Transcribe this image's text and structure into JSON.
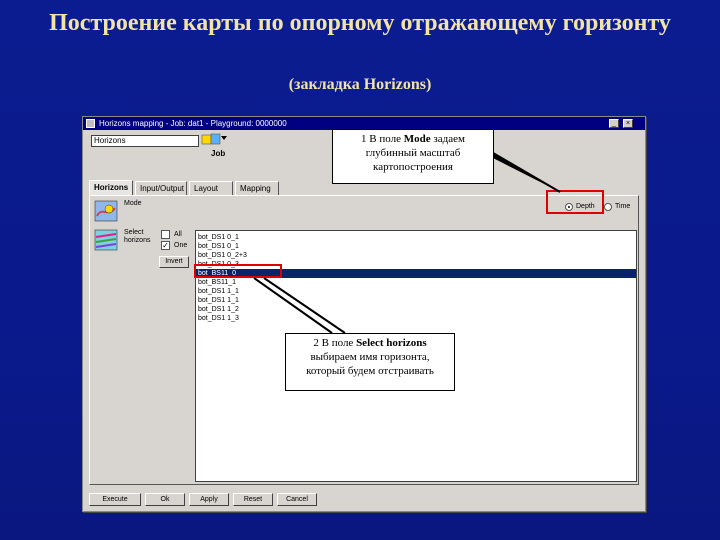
{
  "slide": {
    "title": "Построение карты по опорному отражающему горизонту",
    "subtitle": "(закладка Horizons)"
  },
  "window": {
    "title": "Horizons mapping - Job: dat1 - Playground: 0000000",
    "min_label": "_",
    "close_label": "×",
    "job_field": "Horizons",
    "job_icon_label": "Job",
    "tabs": [
      "Horizons",
      "Input/Output",
      "Layout",
      "Mapping"
    ],
    "mode_label": "Mode",
    "mode_options": [
      "Depth",
      "Time"
    ],
    "select_label": "Select horizons",
    "select_all": "All",
    "select_one": "One",
    "invert_button": "Invert",
    "horizons": [
      "bot_DS1 0_1",
      "bot_DS1 0_1",
      "bot_DS1 0_2+3",
      "bot_DS1 0_3",
      "bot_BS11_0",
      "bot_BS11_1",
      "bot_DS1 1_1",
      "bot_DS1 1_1",
      "bot_DS1 1_2",
      "bot_DS1 1_3"
    ],
    "selected_index": 4,
    "buttons": [
      "Execute",
      "Ok",
      "Apply",
      "Reset",
      "Cancel"
    ]
  },
  "callout1": {
    "num": "1 В поле ",
    "bold": "Mode",
    "rest": " задаем глубинный масштаб картопостроения"
  },
  "callout2": {
    "num": "2 В поле ",
    "bold": "Select horizons",
    "rest": " выбираем имя горизонта, который будем отстраивать"
  },
  "colors": {
    "background": "#0a1a8c",
    "title": "#f2e3a6",
    "highlight_box": "#e00000",
    "selection": "#0a246a"
  }
}
